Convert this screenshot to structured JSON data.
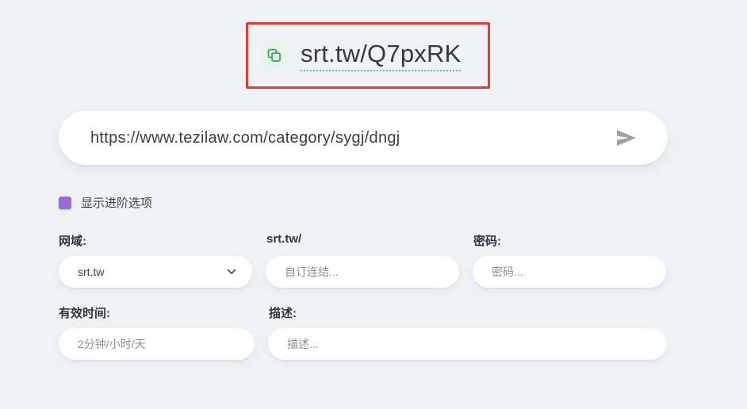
{
  "result": {
    "short_link": "srt.tw/Q7pxRK"
  },
  "url_bar": {
    "value": "https://www.tezilaw.com/category/sygj/dngj"
  },
  "advanced": {
    "label": "显示进阶选项",
    "checked": true
  },
  "form": {
    "domain_label": "网域:",
    "domain_value": "srt.tw",
    "alias_label": "srt.tw/",
    "alias_placeholder": "自订连结...",
    "password_label": "密码:",
    "password_placeholder": "密码...",
    "expiry_label": "有效时间:",
    "expiry_placeholder": "2分钟/小时/天",
    "description_label": "描述:",
    "description_placeholder": "描述..."
  },
  "colors": {
    "highlight_border": "#e53935",
    "checkbox": "#9a6cd3",
    "copy_icon": "#3aa35a",
    "send_icon": "#9aa0a6"
  },
  "icons": {
    "copy": "copy-icon",
    "send": "send-icon",
    "chevron": "chevron-down-icon"
  }
}
